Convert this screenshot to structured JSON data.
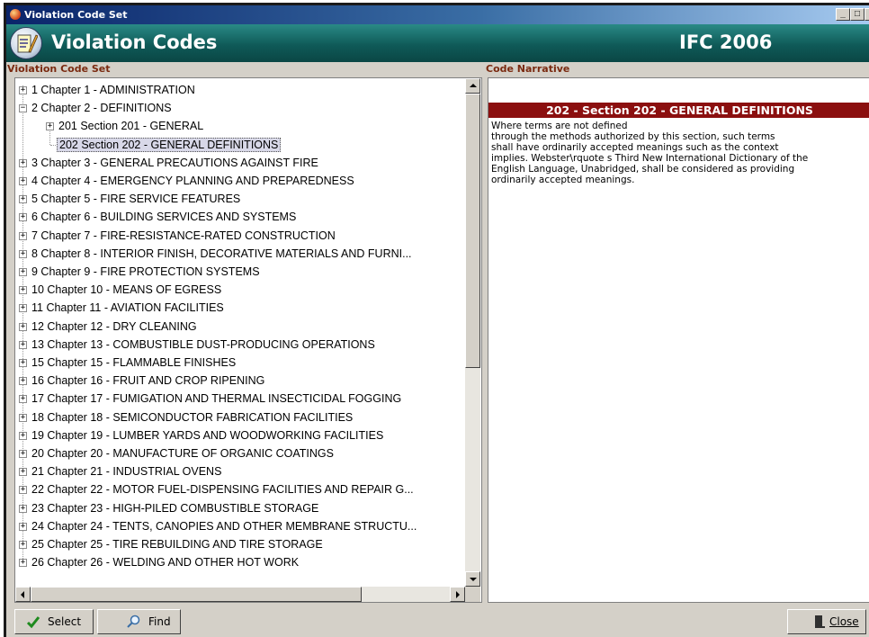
{
  "window": {
    "title": "Violation Code Set"
  },
  "header": {
    "title": "Violation Codes",
    "code": "IFC 2006"
  },
  "left_label": "Violation Code Set",
  "right_label": "Code Narrative",
  "tree": [
    "1 Chapter 1 - ADMINISTRATION",
    "2 Chapter 2 - DEFINITIONS",
    "201 Section 201 - GENERAL",
    "202 Section 202 - GENERAL DEFINITIONS",
    "3 Chapter 3 - GENERAL PRECAUTIONS AGAINST FIRE",
    "4 Chapter 4 - EMERGENCY PLANNING AND PREPAREDNESS",
    "5 Chapter 5 - FIRE SERVICE FEATURES",
    "6 Chapter 6 - BUILDING SERVICES AND SYSTEMS",
    "7 Chapter 7 - FIRE-RESISTANCE-RATED CONSTRUCTION",
    "8 Chapter 8 - INTERIOR FINISH, DECORATIVE MATERIALS AND FURNI...",
    "9 Chapter 9 - FIRE PROTECTION SYSTEMS",
    "10 Chapter 10 - MEANS OF EGRESS",
    "11 Chapter 11 - AVIATION FACILITIES",
    "12 Chapter 12 - DRY CLEANING",
    "13 Chapter 13 - COMBUSTIBLE DUST-PRODUCING OPERATIONS",
    "15 Chapter 15 - FLAMMABLE FINISHES",
    "16 Chapter 16 - FRUIT AND CROP RIPENING",
    "17 Chapter 17 - FUMIGATION AND THERMAL INSECTICIDAL FOGGING",
    "18 Chapter 18 - SEMICONDUCTOR FABRICATION FACILITIES",
    "19 Chapter 19 - LUMBER YARDS AND WOODWORKING FACILITIES",
    "20 Chapter 20 - MANUFACTURE OF ORGANIC COATINGS",
    "21 Chapter 21 - INDUSTRIAL OVENS",
    "22 Chapter 22 - MOTOR FUEL-DISPENSING FACILITIES AND REPAIR G...",
    "23 Chapter 23 - HIGH-PILED COMBUSTIBLE STORAGE",
    "24 Chapter 24 - TENTS, CANOPIES AND OTHER MEMBRANE STRUCTU...",
    "25 Chapter 25 - TIRE REBUILDING AND TIRE STORAGE",
    "26 Chapter 26 - WELDING AND OTHER HOT WORK"
  ],
  "narrative": {
    "heading": "202 - Section 202 - GENERAL DEFINITIONS",
    "body": "Where terms are not defined\nthrough the methods authorized by this section, such terms\nshall have ordinarily accepted meanings such as the context\nimplies. Webster\\rquote s Third New International Dictionary of the\nEnglish Language, Unabridged, shall be considered as providing\nordinarily accepted meanings."
  },
  "buttons": {
    "select": "Select",
    "find": "Find",
    "close": "Close"
  },
  "colors": {
    "header": "#0f5a58",
    "narrative_heading": "#8b0f0f",
    "section_label": "#7a2a10"
  }
}
